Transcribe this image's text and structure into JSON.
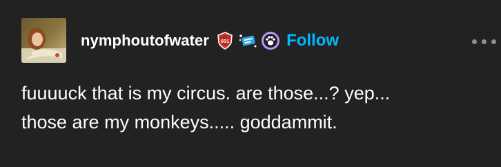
{
  "post": {
    "author": {
      "username": "nymphoutofwater",
      "avatar_icon": "painting-avatar",
      "badges": [
        {
          "icon": "red-shield-badge-icon",
          "label": "601"
        },
        {
          "icon": "blue-sparkle-badge-icon"
        },
        {
          "icon": "paw-badge-icon"
        }
      ]
    },
    "follow_label": "Follow",
    "menu_icon": "more-options-icon",
    "body_lines": [
      "fuuuuck that is my circus. are those...? yep...",
      "those are my monkeys..... goddammit."
    ]
  },
  "colors": {
    "background": "#222222",
    "text": "#ffffff",
    "accent": "#00b8ff"
  }
}
